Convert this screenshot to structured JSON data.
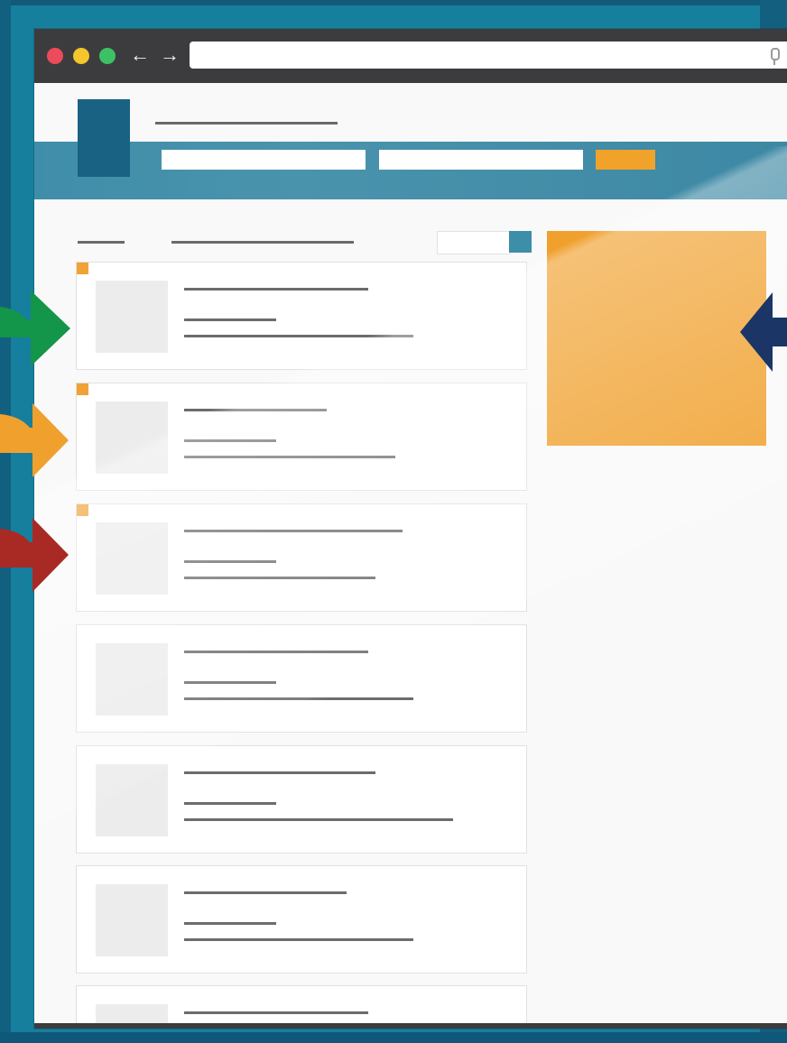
{
  "browser": {
    "nav_back_glyph": "←",
    "nav_forward_glyph": "→",
    "url": "",
    "icons": [
      "close-dot",
      "minimize-dot",
      "maximize-dot",
      "back-arrow-icon",
      "forward-arrow-icon",
      "microphone-icon"
    ]
  },
  "site": {
    "search_button_label": "",
    "listings_count_shown": 7
  },
  "colors": {
    "background": "#167f9d",
    "logo": "#1a6283",
    "nav_band": "#4a93ad",
    "accent_orange": "#f0a02d",
    "arrow_green": "#13954a",
    "arrow_orange": "#f0a02d",
    "arrow_red": "#a92a24",
    "arrow_navy": "#1c3567"
  },
  "callouts": [
    "green-arrow",
    "orange-arrow",
    "red-arrow",
    "navy-arrow"
  ]
}
